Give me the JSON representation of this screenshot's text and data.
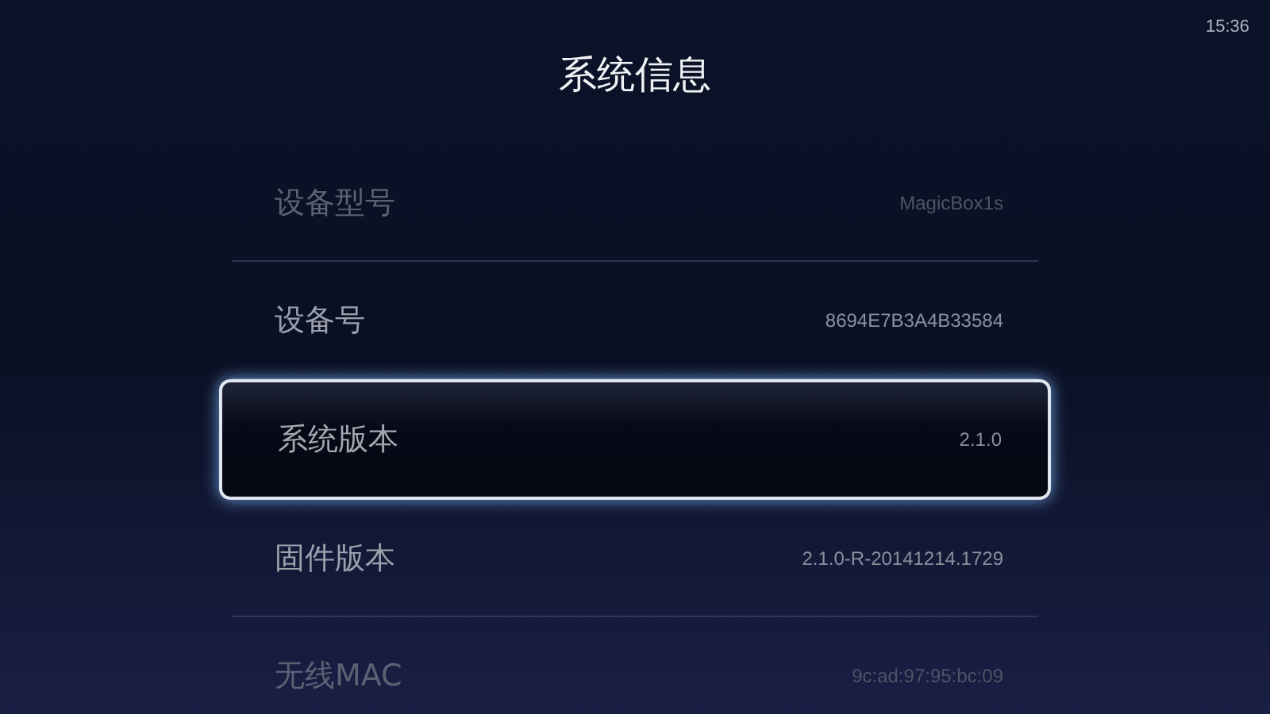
{
  "status_bar": {
    "time": "15:36"
  },
  "title": "系统信息",
  "rows": [
    {
      "label": "设备型号",
      "value": "MagicBox1s",
      "selected": false,
      "dimmed": true
    },
    {
      "label": "设备号",
      "value": "8694E7B3A4B33584",
      "selected": false,
      "dimmed": false
    },
    {
      "label": "系统版本",
      "value": "2.1.0",
      "selected": true,
      "dimmed": false
    },
    {
      "label": "固件版本",
      "value": "2.1.0-R-20141214.1729",
      "selected": false,
      "dimmed": false
    },
    {
      "label": "无线MAC",
      "value": "9c:ad:97:95:bc:09",
      "selected": false,
      "dimmed": true
    }
  ]
}
